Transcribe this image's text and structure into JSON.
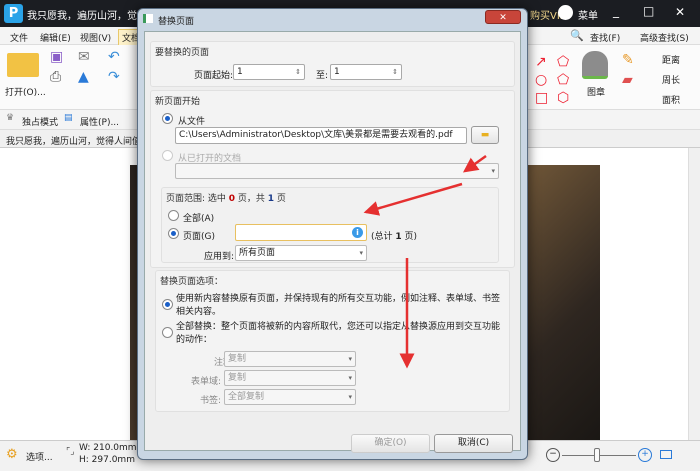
{
  "app": {
    "title": "我只愿我，遍历山河，觉",
    "vip": "购买VIP",
    "menu_label": "菜单",
    "minimize": "_",
    "maximize": "□",
    "close": "✕"
  },
  "menubar": {
    "items": [
      "文件",
      "编辑(E)",
      "视图(V)",
      "文档"
    ]
  },
  "ribbon": {
    "open": "打开(O)...",
    "find": "查找(F)",
    "adv_find": "高级查找(S)",
    "stamp": "图章",
    "distance": "距离",
    "perimeter": "周长",
    "area": "面积"
  },
  "quick": {
    "exclusive": "独占模式",
    "properties": "属性(P)..."
  },
  "tab": {
    "label": "我只愿我，遍历山河，觉得人间值"
  },
  "status": {
    "options": "选项...",
    "width": "W: 210.0mm",
    "height": "H: 297.0mm"
  },
  "dialog": {
    "title": "替换页面",
    "close": "✕",
    "g1": {
      "header": "要替换的页面",
      "start_label": "页面起始:",
      "start_value": "1",
      "to_label": "至:",
      "to_value": "1"
    },
    "g2": {
      "header": "新页面开始",
      "from_file": "从文件",
      "file_path": "C:\\Users\\Administrator\\Desktop\\文库\\美景都是需要去观看的.pdf",
      "from_open": "从已打开的文档",
      "range_header_prefix": "页面范围: 选中 ",
      "range_selected": "0",
      "range_mid": " 页，共 ",
      "range_total": "1",
      "range_suffix": " 页",
      "all": "全部(A)",
      "pages": "页面(G)",
      "pages_value": "",
      "total_note_prefix": "(总计 ",
      "total_note_num": "1",
      "total_note_suffix": " 页)",
      "apply_label": "应用到:",
      "apply_value": "所有页面"
    },
    "g3": {
      "header": "替换页面选项：",
      "opt1": "使用新内容替换原有页面，并保持现有的所有交互功能，例如注释、表单域、书签相关内容。",
      "opt2": "全部替换：整个页面将被新的内容所取代，您还可以指定从替换源应用到交互功能的动作：",
      "annot_label": "注释:",
      "annot_value": "复制",
      "form_label": "表单域:",
      "form_value": "复制",
      "bookmark_label": "书签:",
      "bookmark_value": "全部复制"
    },
    "ok": "确定(O)",
    "cancel": "取消(C)"
  },
  "colors": {
    "accent": "#1a5fc8",
    "arrow": "#e53030",
    "selected_count": "#c00000"
  }
}
